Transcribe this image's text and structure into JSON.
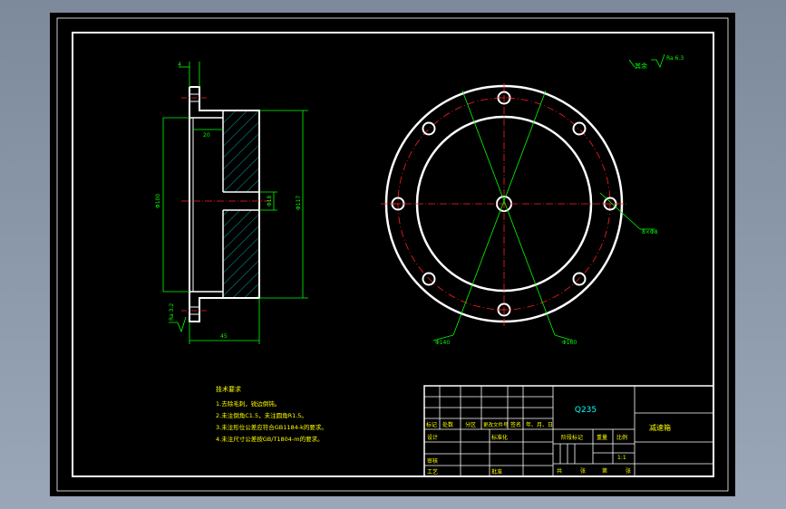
{
  "colors": {
    "background": "#000000",
    "frame": "#ffffff",
    "outline": "#ffffff",
    "dimension": "#00ff00",
    "centerline": "#ff2020",
    "hatch": "#00d0d0",
    "text": "#ffff00",
    "material": "#00ffff"
  },
  "drawing": {
    "roughness_note": "其余",
    "roughness_value": "Ra 6.3",
    "section_roughness_value": "Ra 3.2",
    "dim_top": "4",
    "dim_bore_depth": "20",
    "dim_left_dia": "Φ100",
    "dim_hole_dia": "Φ18",
    "dim_right_dia": "Φ117",
    "dim_length": "45",
    "dim_holes": "8×Φ8",
    "dim_pcd_left": "Φ140",
    "dim_pcd_right": "Φ160"
  },
  "notes": {
    "title": "技术要求",
    "items": [
      "1.去除毛刺，锐边倒钝。",
      "2.未注倒角C1.5，未注圆角R1.5。",
      "3.未注形位公差应符合GB1184-k的要求。",
      "4.未注尺寸公差按GB/T1804-m的要求。"
    ]
  },
  "title_block": {
    "material": "Q235",
    "part_name": "减速箱",
    "mark": "标记",
    "count": "处数",
    "zone": "分区",
    "change_doc": "更改文件号",
    "signature": "签名",
    "date": "年、月、日",
    "design": "设计",
    "standardize": "标准化",
    "stage_mark": "阶段标记",
    "weight": "重量",
    "scale_label": "比例",
    "scale": "1:1",
    "review": "审核",
    "process": "工艺",
    "approve": "批准",
    "sheet_total": "共",
    "sheet_of": "张",
    "sheet_no": "第"
  }
}
